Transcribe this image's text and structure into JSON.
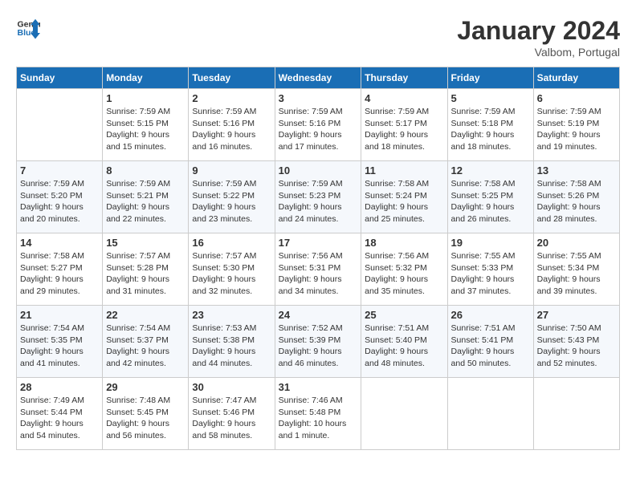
{
  "header": {
    "logo_line1": "General",
    "logo_line2": "Blue",
    "month": "January 2024",
    "location": "Valbom, Portugal"
  },
  "weekdays": [
    "Sunday",
    "Monday",
    "Tuesday",
    "Wednesday",
    "Thursday",
    "Friday",
    "Saturday"
  ],
  "weeks": [
    [
      {
        "day": "",
        "info": ""
      },
      {
        "day": "1",
        "info": "Sunrise: 7:59 AM\nSunset: 5:15 PM\nDaylight: 9 hours\nand 15 minutes."
      },
      {
        "day": "2",
        "info": "Sunrise: 7:59 AM\nSunset: 5:16 PM\nDaylight: 9 hours\nand 16 minutes."
      },
      {
        "day": "3",
        "info": "Sunrise: 7:59 AM\nSunset: 5:16 PM\nDaylight: 9 hours\nand 17 minutes."
      },
      {
        "day": "4",
        "info": "Sunrise: 7:59 AM\nSunset: 5:17 PM\nDaylight: 9 hours\nand 18 minutes."
      },
      {
        "day": "5",
        "info": "Sunrise: 7:59 AM\nSunset: 5:18 PM\nDaylight: 9 hours\nand 18 minutes."
      },
      {
        "day": "6",
        "info": "Sunrise: 7:59 AM\nSunset: 5:19 PM\nDaylight: 9 hours\nand 19 minutes."
      }
    ],
    [
      {
        "day": "7",
        "info": "Sunrise: 7:59 AM\nSunset: 5:20 PM\nDaylight: 9 hours\nand 20 minutes."
      },
      {
        "day": "8",
        "info": "Sunrise: 7:59 AM\nSunset: 5:21 PM\nDaylight: 9 hours\nand 22 minutes."
      },
      {
        "day": "9",
        "info": "Sunrise: 7:59 AM\nSunset: 5:22 PM\nDaylight: 9 hours\nand 23 minutes."
      },
      {
        "day": "10",
        "info": "Sunrise: 7:59 AM\nSunset: 5:23 PM\nDaylight: 9 hours\nand 24 minutes."
      },
      {
        "day": "11",
        "info": "Sunrise: 7:58 AM\nSunset: 5:24 PM\nDaylight: 9 hours\nand 25 minutes."
      },
      {
        "day": "12",
        "info": "Sunrise: 7:58 AM\nSunset: 5:25 PM\nDaylight: 9 hours\nand 26 minutes."
      },
      {
        "day": "13",
        "info": "Sunrise: 7:58 AM\nSunset: 5:26 PM\nDaylight: 9 hours\nand 28 minutes."
      }
    ],
    [
      {
        "day": "14",
        "info": "Sunrise: 7:58 AM\nSunset: 5:27 PM\nDaylight: 9 hours\nand 29 minutes."
      },
      {
        "day": "15",
        "info": "Sunrise: 7:57 AM\nSunset: 5:28 PM\nDaylight: 9 hours\nand 31 minutes."
      },
      {
        "day": "16",
        "info": "Sunrise: 7:57 AM\nSunset: 5:30 PM\nDaylight: 9 hours\nand 32 minutes."
      },
      {
        "day": "17",
        "info": "Sunrise: 7:56 AM\nSunset: 5:31 PM\nDaylight: 9 hours\nand 34 minutes."
      },
      {
        "day": "18",
        "info": "Sunrise: 7:56 AM\nSunset: 5:32 PM\nDaylight: 9 hours\nand 35 minutes."
      },
      {
        "day": "19",
        "info": "Sunrise: 7:55 AM\nSunset: 5:33 PM\nDaylight: 9 hours\nand 37 minutes."
      },
      {
        "day": "20",
        "info": "Sunrise: 7:55 AM\nSunset: 5:34 PM\nDaylight: 9 hours\nand 39 minutes."
      }
    ],
    [
      {
        "day": "21",
        "info": "Sunrise: 7:54 AM\nSunset: 5:35 PM\nDaylight: 9 hours\nand 41 minutes."
      },
      {
        "day": "22",
        "info": "Sunrise: 7:54 AM\nSunset: 5:37 PM\nDaylight: 9 hours\nand 42 minutes."
      },
      {
        "day": "23",
        "info": "Sunrise: 7:53 AM\nSunset: 5:38 PM\nDaylight: 9 hours\nand 44 minutes."
      },
      {
        "day": "24",
        "info": "Sunrise: 7:52 AM\nSunset: 5:39 PM\nDaylight: 9 hours\nand 46 minutes."
      },
      {
        "day": "25",
        "info": "Sunrise: 7:51 AM\nSunset: 5:40 PM\nDaylight: 9 hours\nand 48 minutes."
      },
      {
        "day": "26",
        "info": "Sunrise: 7:51 AM\nSunset: 5:41 PM\nDaylight: 9 hours\nand 50 minutes."
      },
      {
        "day": "27",
        "info": "Sunrise: 7:50 AM\nSunset: 5:43 PM\nDaylight: 9 hours\nand 52 minutes."
      }
    ],
    [
      {
        "day": "28",
        "info": "Sunrise: 7:49 AM\nSunset: 5:44 PM\nDaylight: 9 hours\nand 54 minutes."
      },
      {
        "day": "29",
        "info": "Sunrise: 7:48 AM\nSunset: 5:45 PM\nDaylight: 9 hours\nand 56 minutes."
      },
      {
        "day": "30",
        "info": "Sunrise: 7:47 AM\nSunset: 5:46 PM\nDaylight: 9 hours\nand 58 minutes."
      },
      {
        "day": "31",
        "info": "Sunrise: 7:46 AM\nSunset: 5:48 PM\nDaylight: 10 hours\nand 1 minute."
      },
      {
        "day": "",
        "info": ""
      },
      {
        "day": "",
        "info": ""
      },
      {
        "day": "",
        "info": ""
      }
    ]
  ]
}
